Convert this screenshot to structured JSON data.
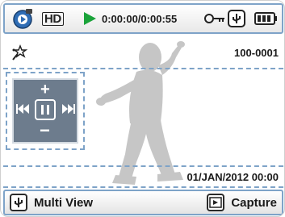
{
  "status_bar": {
    "mode_icon": "playback-mode-icon",
    "quality_label": "HD",
    "play_state_icon": "play-icon",
    "timecode": "0:00:00/0:00:55",
    "protect_icon": "key-icon",
    "usb_icon": "usb-icon",
    "battery_icon": "battery-icon"
  },
  "info_row": {
    "effect_icon": "effect-icon",
    "file_number": "100-0001"
  },
  "control_pad": {
    "volume_up": "+",
    "volume_down": "−",
    "prev_icon": "skip-back-icon",
    "pause_icon": "pause-icon",
    "next_icon": "skip-forward-icon"
  },
  "date_row": {
    "date_time": "01/JAN/2012 00:00"
  },
  "bottom_bar": {
    "multi_view_label": "Multi View",
    "capture_label": "Capture"
  },
  "colors": {
    "accent_border": "#7ea3c8",
    "play_green": "#1aa33a",
    "pad_bg": "#6d7c8d",
    "silhouette": "#c6c6c6"
  }
}
